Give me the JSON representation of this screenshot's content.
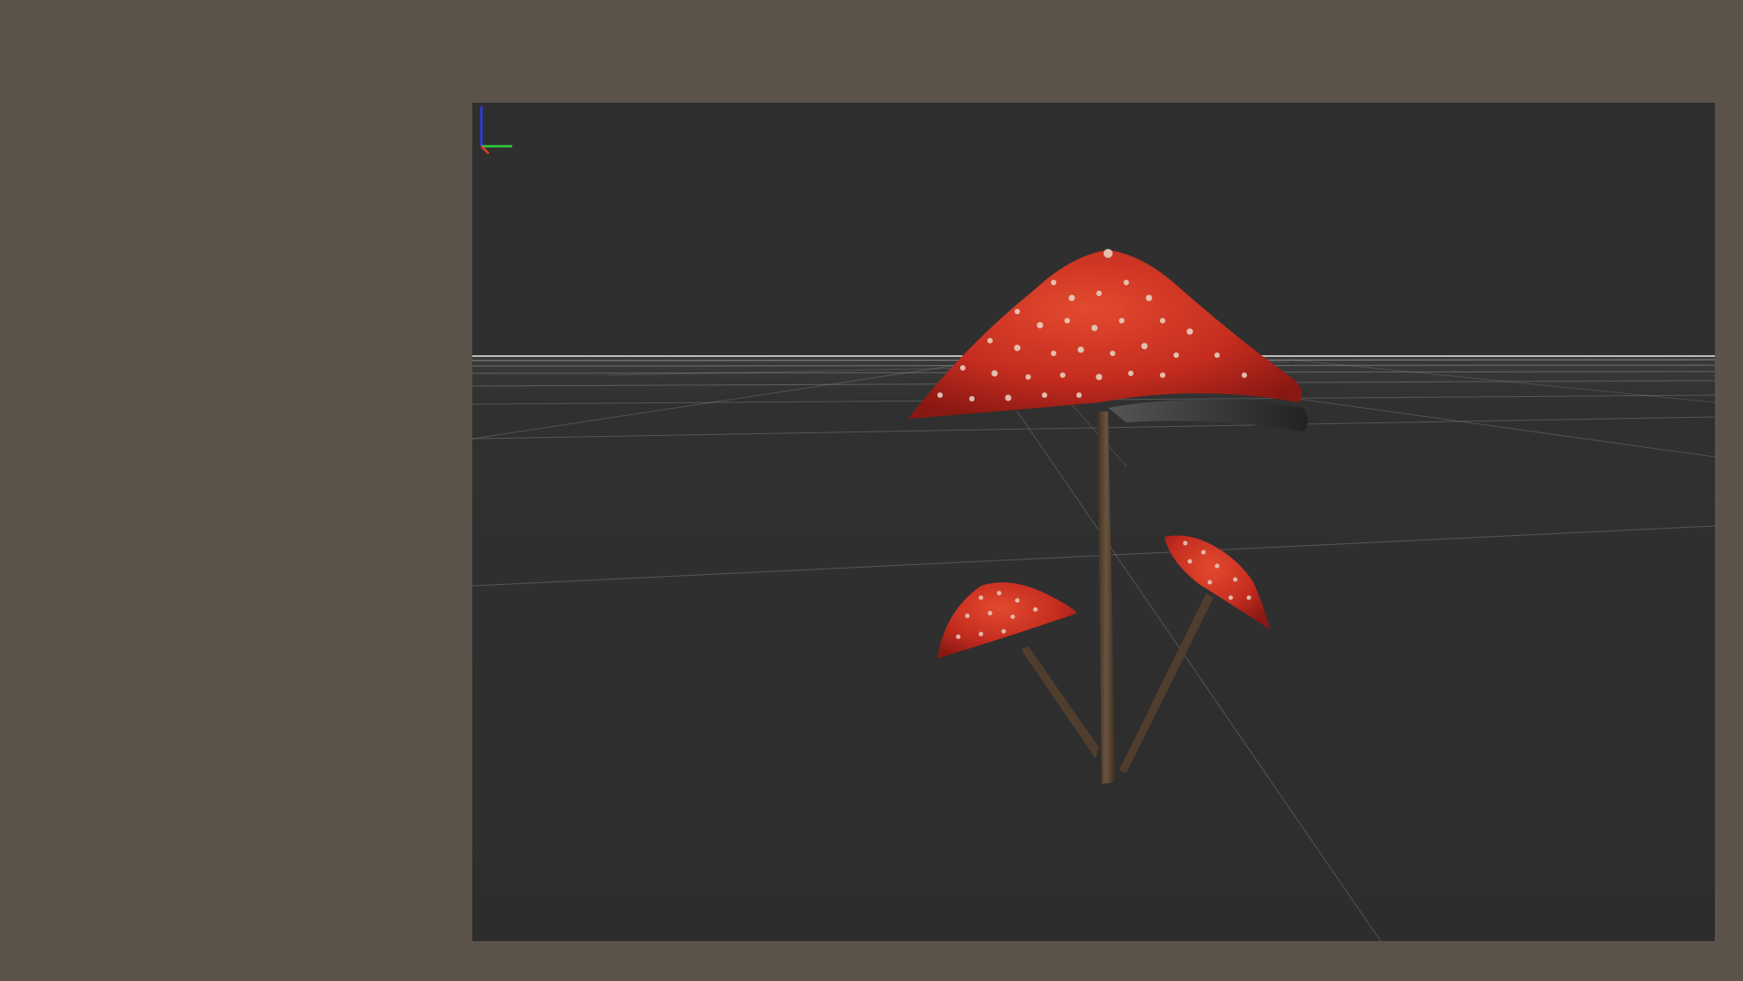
{
  "window": {
    "background_color": "#5b524a"
  },
  "viewport": {
    "background_color": "#2f2f2f",
    "grid_color": "#9a9a9a",
    "horizon_color": "#cfcfcf"
  },
  "model": {
    "icon": "mushroom-model",
    "cap_color": "#b8261c",
    "cap_highlight": "#e24a2e",
    "spot_color": "#e8d8c8",
    "stem_color": "#5a4634"
  },
  "axis_gizmo": {
    "icon": "axis-gizmo-icon",
    "x_color": "#e23b2e",
    "y_color": "#2ecc40",
    "z_color": "#2a3cff"
  }
}
